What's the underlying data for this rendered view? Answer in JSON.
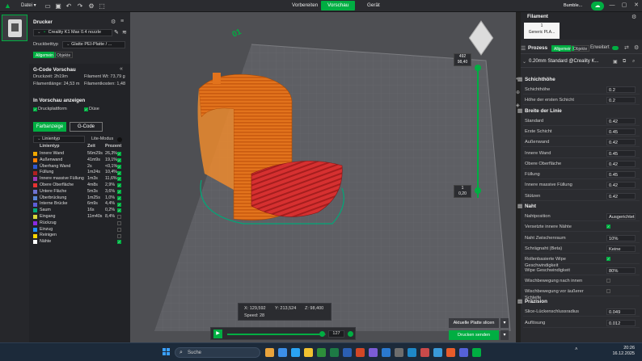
{
  "topbar": {
    "menu_label": "Datei",
    "tabs": [
      {
        "label": "Vorbereiten",
        "active": false
      },
      {
        "label": "Vorschau",
        "active": true
      },
      {
        "label": "Gerät",
        "active": false
      }
    ],
    "user": "Bumble...",
    "accent": "#00ae42"
  },
  "printer": {
    "title": "Drucker",
    "printer_name": "Creality K1 Max 0.4 nozzle",
    "bed_label": "Druckbetttyp",
    "bed_value": "Glatte PEI-Platte / ...",
    "tabs": [
      "Allgemein",
      "Objekte"
    ]
  },
  "gcode": {
    "title": "G-Code Vorschau",
    "print_time": "Druckzeit: 2h19m",
    "filament_weight": "Filament Wt: 73,79 g",
    "filament_length": "Filamentlänge: 24,53 m",
    "filament_cost": "Filamentkosten: 1,48"
  },
  "preview": {
    "title": "In Vorschau anzeigen",
    "options": [
      "Druckplattform",
      "Düse"
    ]
  },
  "view_tabs": [
    "Farbanzeige",
    "G-Code"
  ],
  "linetype": {
    "select_label": "Linientyp",
    "lite_mode": "Lite-Modus",
    "headers": [
      "Linientyp",
      "Zeit",
      "Prozent"
    ],
    "rows": [
      {
        "name": "Innere Wand",
        "time": "56m29s",
        "pct": "26,3%",
        "color": "#f0a800",
        "checked": true
      },
      {
        "name": "Außenwand",
        "time": "41m9s",
        "pct": "19,1%",
        "color": "#ff7f00",
        "checked": true
      },
      {
        "name": "Überhang Wand",
        "time": "2s",
        "pct": "<0,1%",
        "color": "#2f57cf",
        "checked": true
      },
      {
        "name": "Füllung",
        "time": "1m24s",
        "pct": "10,4%",
        "color": "#b02020",
        "checked": true
      },
      {
        "name": "Innere massive Füllung",
        "time": "1m3s",
        "pct": "11,6%",
        "color": "#9c3aba",
        "checked": true
      },
      {
        "name": "Obere Oberfläche",
        "time": "4m8s",
        "pct": "2,9%",
        "color": "#e83232",
        "checked": true
      },
      {
        "name": "Untere Fläche",
        "time": "5m3s",
        "pct": "3,6%",
        "color": "#6f73d1",
        "checked": true
      },
      {
        "name": "Überbrückung",
        "time": "1m25s",
        "pct": "1,0%",
        "color": "#5a86d6",
        "checked": true
      },
      {
        "name": "Interne Brücke",
        "time": "6m9s",
        "pct": "4,4%",
        "color": "#5e5ed6",
        "checked": true
      },
      {
        "name": "Saum",
        "time": "16s",
        "pct": "0,2%",
        "color": "#00a878",
        "checked": true
      },
      {
        "name": "Eingang",
        "time": "11m40s",
        "pct": "8,4%",
        "color": "#d8d83a",
        "checked": false
      },
      {
        "name": "Rückzug",
        "time": "",
        "pct": "",
        "color": "#8a2be2",
        "checked": false
      },
      {
        "name": "Einzug",
        "time": "",
        "pct": "",
        "color": "#1e90ff",
        "checked": false
      },
      {
        "name": "Reinigen",
        "time": "",
        "pct": "",
        "color": "#ffd700",
        "checked": false
      },
      {
        "name": "Nähte",
        "time": "",
        "pct": "",
        "color": "#ffffff",
        "checked": true
      }
    ]
  },
  "viewport": {
    "coords": {
      "x": "X: 129,592",
      "y": "Y: 213,524",
      "z": "Z: 98,400",
      "speed": "Speed: 28"
    },
    "layer_top": {
      "layer": "492",
      "height": "98,40"
    },
    "layer_bottom": {
      "layer": "1",
      "height": "0,20"
    },
    "plate_number": "01",
    "move_value": "127",
    "progress": 0.96,
    "slice_btn": "Aktuelle Platte slicen",
    "send_btn": "Drucken senden"
  },
  "filament": {
    "title": "Filament",
    "slot_number": "1",
    "slot_name": "Generic PLA..."
  },
  "process": {
    "title": "Prozess",
    "tabs": [
      "Allgemein",
      "Objekte"
    ],
    "advanced": "Erweitert",
    "profile": "0.20mm Standard @Creality K...",
    "groups": [
      {
        "title": "Schichthöhe",
        "params": [
          {
            "name": "Schichthöhe",
            "value": "0.2"
          },
          {
            "name": "Höhe der ersten Schicht",
            "value": "0.2"
          }
        ]
      },
      {
        "title": "Breite der Linie",
        "params": [
          {
            "name": "Standard",
            "value": "0.42"
          },
          {
            "name": "Erste Schicht",
            "value": "0.45"
          },
          {
            "name": "Außenwand",
            "value": "0.42"
          },
          {
            "name": "Innere Wand",
            "value": "0.45"
          },
          {
            "name": "Obere Oberfläche",
            "value": "0.42"
          },
          {
            "name": "Füllung",
            "value": "0.45"
          },
          {
            "name": "Innere massive Füllung",
            "value": "0.42"
          },
          {
            "name": "Stützen",
            "value": "0.42"
          }
        ]
      },
      {
        "title": "Naht",
        "params": [
          {
            "name": "Nahtposition",
            "value": "Ausgerichtet"
          },
          {
            "name": "Versetzte innere Nähte",
            "value": "✓"
          },
          {
            "name": "Naht Zwischenraum",
            "value": "10%"
          },
          {
            "name": "Schrägnaht (Beta)",
            "value": "Keine"
          },
          {
            "name": "Rollenbasierte Wipe Geschwindigkeit",
            "value": "✓"
          },
          {
            "name": "Wipe Geschwindigkeit",
            "value": "80%"
          },
          {
            "name": "Wischbewegung nach innen",
            "value": ""
          },
          {
            "name": "Wischbewegung vor äußerer Schleife",
            "value": ""
          }
        ]
      },
      {
        "title": "Präzision",
        "params": [
          {
            "name": "Slice-Lückenschlussradius",
            "value": "0.049"
          },
          {
            "name": "Auflösung",
            "value": "0.012"
          }
        ]
      }
    ]
  },
  "taskbar": {
    "search": "Suche",
    "time": "20:26",
    "date": "16.12.2025"
  }
}
